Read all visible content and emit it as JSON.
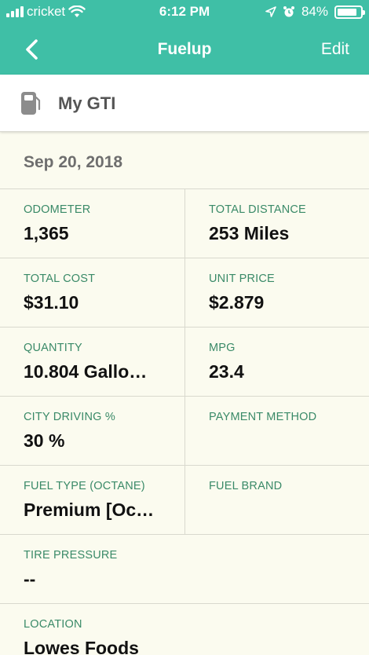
{
  "status_bar": {
    "carrier": "cricket",
    "time": "6:12 PM",
    "battery": "84%",
    "battery_level": 0.84
  },
  "nav": {
    "title": "Fuelup",
    "edit_label": "Edit"
  },
  "vehicle": {
    "name": "My GTI"
  },
  "date": "Sep 20, 2018",
  "fields": [
    {
      "label": "ODOMETER",
      "value": "1,365"
    },
    {
      "label": "TOTAL DISTANCE",
      "value": "253 Miles"
    },
    {
      "label": "TOTAL COST",
      "value": "$31.10"
    },
    {
      "label": "UNIT PRICE",
      "value": "$2.879"
    },
    {
      "label": "QUANTITY",
      "value": "10.804 Gallo…"
    },
    {
      "label": "MPG",
      "value": "23.4"
    },
    {
      "label": "CITY DRIVING %",
      "value": "30 %"
    },
    {
      "label": "PAYMENT METHOD",
      "value": ""
    },
    {
      "label": "FUEL TYPE (OCTANE)",
      "value": "Premium [Oc…"
    },
    {
      "label": "FUEL BRAND",
      "value": ""
    },
    {
      "label": "TIRE PRESSURE",
      "value": "--"
    },
    {
      "label": "LOCATION",
      "value": "Lowes Foods"
    }
  ],
  "colors": {
    "header": "#3fbfa6",
    "background": "#fbfbef",
    "label": "#3a8a68"
  }
}
